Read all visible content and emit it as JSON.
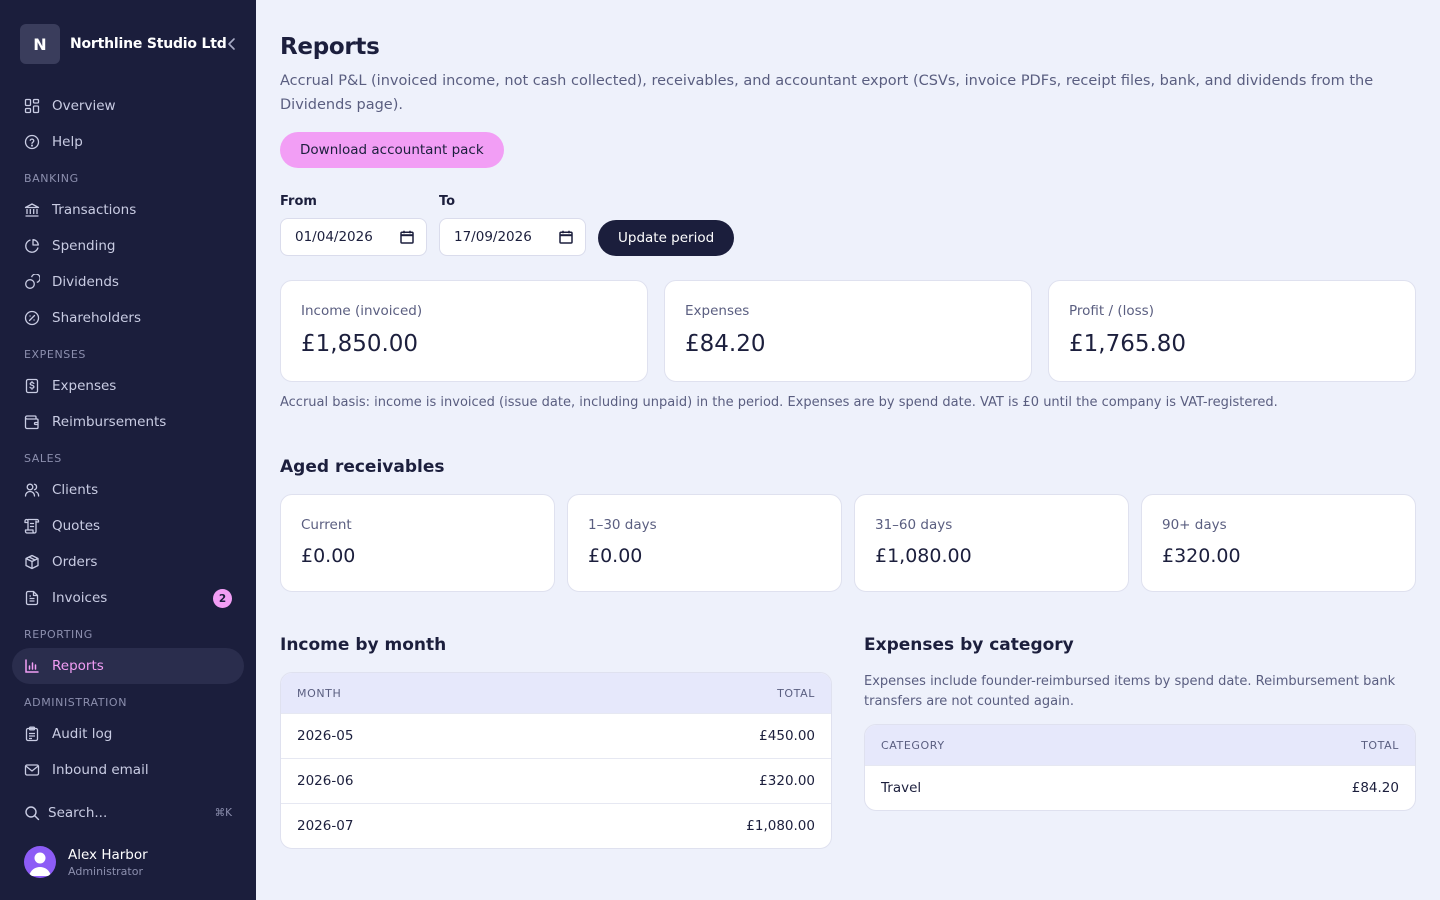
{
  "sidebar": {
    "brand": {
      "logo_letter": "N",
      "name": "Northline Studio Ltd"
    },
    "items": {
      "overview": "Overview",
      "help": "Help",
      "transactions": "Transactions",
      "spending": "Spending",
      "dividends": "Dividends",
      "shareholders": "Shareholders",
      "expenses": "Expenses",
      "reimbursements": "Reimbursements",
      "clients": "Clients",
      "quotes": "Quotes",
      "orders": "Orders",
      "invoices": "Invoices",
      "reports": "Reports",
      "audit_log": "Audit log",
      "inbound_email": "Inbound email"
    },
    "sections": {
      "banking": "BANKING",
      "expenses": "EXPENSES",
      "sales": "SALES",
      "reporting": "REPORTING",
      "administration": "ADMINISTRATION"
    },
    "invoices_badge": "2",
    "active_item": "Reports",
    "search": {
      "label": "Search...",
      "shortcut": "⌘K"
    },
    "user": {
      "name": "Alex Harbor",
      "role": "Administrator"
    }
  },
  "page": {
    "title": "Reports",
    "description": "Accrual P&L (invoiced income, not cash collected), receivables, and accountant export (CSVs, invoice PDFs, receipt files, bank, and dividends from the Dividends page).",
    "download_button": "Download accountant pack",
    "period": {
      "from_label": "From",
      "from_value": "01/04/2026",
      "to_label": "To",
      "to_value": "17/09/2026",
      "update_button": "Update period"
    },
    "summary": [
      {
        "label": "Income (invoiced)",
        "value": "£1,850.00"
      },
      {
        "label": "Expenses",
        "value": "£84.20"
      },
      {
        "label": "Profit / (loss)",
        "value": "£1,765.80"
      }
    ],
    "basis_note": "Accrual basis: income is invoiced (issue date, including unpaid) in the period. Expenses are by spend date. VAT is £0 until the company is VAT-registered.",
    "aged": {
      "title": "Aged receivables",
      "buckets": [
        {
          "label": "Current",
          "value": "£0.00"
        },
        {
          "label": "1–30 days",
          "value": "£0.00"
        },
        {
          "label": "31–60 days",
          "value": "£1,080.00"
        },
        {
          "label": "90+ days",
          "value": "£320.00"
        }
      ]
    },
    "income_by_month": {
      "title": "Income by month",
      "columns": [
        "MONTH",
        "TOTAL"
      ],
      "rows": [
        {
          "month": "2026-05",
          "total": "£450.00"
        },
        {
          "month": "2026-06",
          "total": "£320.00"
        },
        {
          "month": "2026-07",
          "total": "£1,080.00"
        }
      ]
    },
    "expenses_by_category": {
      "title": "Expenses by category",
      "note": "Expenses include founder-reimbursed items by spend date. Reimbursement bank transfers are not counted again.",
      "columns": [
        "CATEGORY",
        "TOTAL"
      ],
      "rows": [
        {
          "category": "Travel",
          "total": "£84.20"
        }
      ]
    }
  },
  "colors": {
    "sidebar_bg": "#1b1e3c",
    "accent_pink": "#f29ef5",
    "page_bg": "#eef1fb",
    "table_header_bg": "#e6e8fb",
    "avatar": "#8d5cf6"
  },
  "icons": {
    "overview": "grid-icon",
    "help": "help-circle-icon",
    "transactions": "bank-icon",
    "spending": "pie-chart-icon",
    "dividends": "coins-icon",
    "shareholders": "badge-icon",
    "expenses": "receipt-dollar-icon",
    "reimbursements": "wallet-icon",
    "clients": "users-icon",
    "quotes": "scroll-icon",
    "orders": "package-icon",
    "invoices": "file-text-icon",
    "reports": "bar-chart-icon",
    "audit_log": "clipboard-icon",
    "inbound_email": "mail-icon"
  }
}
